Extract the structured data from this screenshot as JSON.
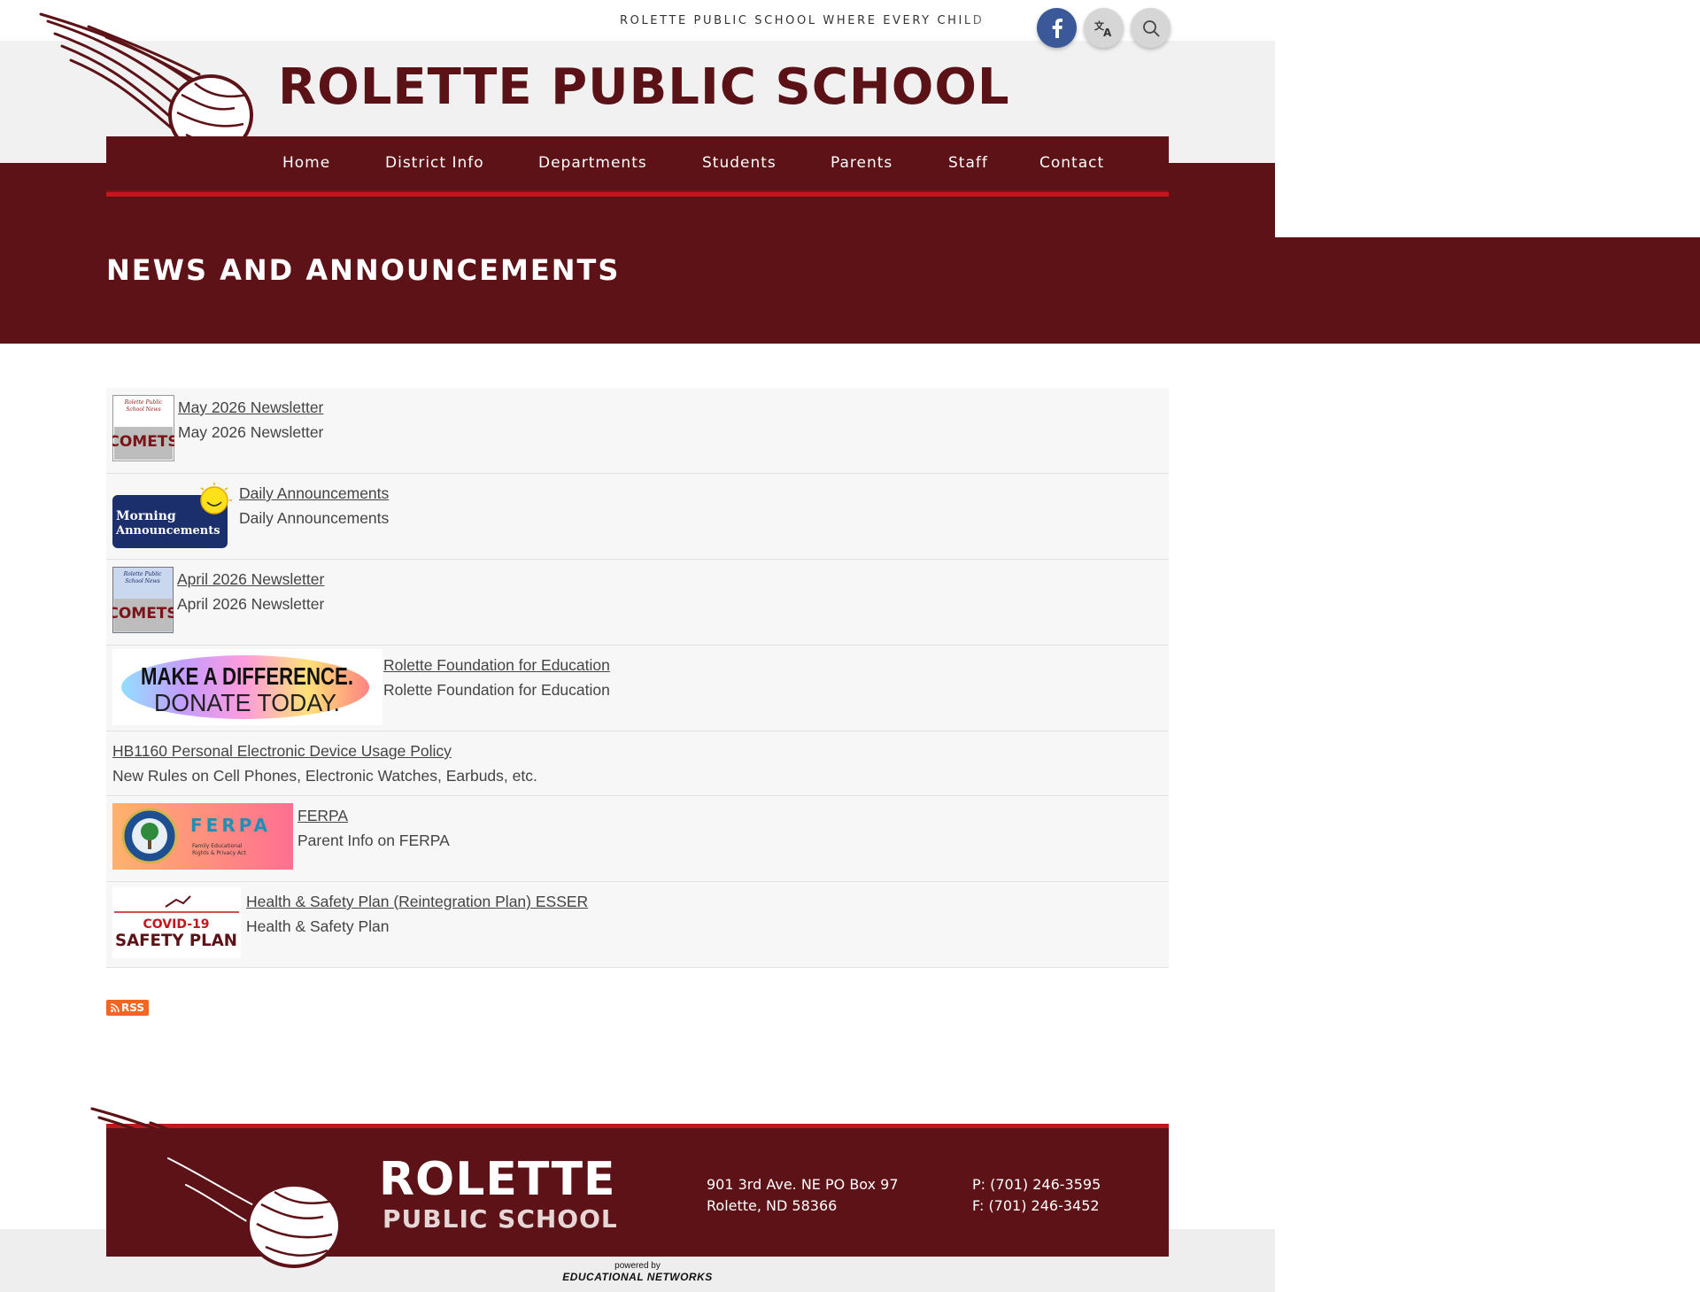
{
  "header": {
    "tagline": "ROLETTE PUBLIC SCHOOL WHERE EVERY CHILD MAT",
    "school_name": "ROLETTE PUBLIC SCHOOL",
    "buttons": [
      "facebook-icon",
      "translate-icon",
      "search-icon"
    ]
  },
  "nav": {
    "items": [
      {
        "label": "Home"
      },
      {
        "label": "District Info"
      },
      {
        "label": "Departments"
      },
      {
        "label": "Students"
      },
      {
        "label": "Parents"
      },
      {
        "label": "Staff"
      },
      {
        "label": "Contact"
      }
    ]
  },
  "hero": {
    "title": "NEWS AND ANNOUNCEMENTS"
  },
  "news": [
    {
      "title": "May 2026 Newsletter",
      "description": "May 2026 Newsletter",
      "thumb": "comets-newsletter",
      "thumb_text": "COMETS"
    },
    {
      "title": "Daily Announcements",
      "description": "Daily Announcements",
      "thumb": "morning-announcements",
      "thumb_text": "Morning Announcements"
    },
    {
      "title": "April 2026 Newsletter",
      "description": "April 2026 Newsletter",
      "thumb": "comets-newsletter",
      "thumb_text": "COMETS"
    },
    {
      "title": "Rolette Foundation for Education",
      "description": "Rolette Foundation for Education",
      "thumb": "donate-banner",
      "thumb_text_1": "MAKE A DIFFERENCE.",
      "thumb_text_2": "DONATE TODAY."
    },
    {
      "title": "HB1160 Personal Electronic Device Usage Policy",
      "description": "New Rules on Cell Phones, Electronic Watches, Earbuds, etc."
    },
    {
      "title": "FERPA",
      "description": "Parent Info on FERPA",
      "thumb": "ferpa-banner",
      "thumb_text_1": "FERPA",
      "thumb_text_2": "Family Educational Rights & Privacy Act"
    },
    {
      "title": "Health & Safety Plan (Reintegration Plan) ESSER",
      "description": "Health & Safety Plan",
      "thumb": "covid-safety-plan",
      "thumb_text_1": "COVID-19",
      "thumb_text_2": "SAFETY PLAN"
    }
  ],
  "rss_label": "RSS",
  "footer": {
    "name_line1": "ROLETTE",
    "name_line2": "PUBLIC SCHOOL",
    "address_line1": "901 3rd Ave. NE PO Box 97",
    "address_line2": "Rolette, ND 58366",
    "phone": "P:  (701) 246-3595",
    "fax": "F:  (701) 246-3452",
    "powered_by": "powered by",
    "provider": "EDUCATIONAL NETWORKS"
  },
  "colors": {
    "maroon": "#5c1216",
    "accent_red": "#c4161c",
    "facebook": "#3b5998",
    "rss": "#f26522"
  }
}
